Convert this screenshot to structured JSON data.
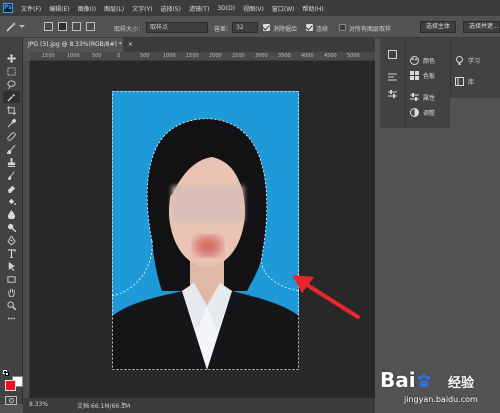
{
  "menubar": {
    "logo": "Ps",
    "items": [
      "文件(F)",
      "编辑(E)",
      "图像(I)",
      "图层(L)",
      "文字(Y)",
      "选择(S)",
      "滤镜(T)",
      "3D(D)",
      "视图(V)",
      "窗口(W)",
      "帮助(H)"
    ]
  },
  "options": {
    "sample_size_label": "取样大小：",
    "sample_size_value": "取样点",
    "tolerance_label": "容差：",
    "tolerance_value": "32",
    "antialias_label": "消除锯齿",
    "contiguous_label": "连续",
    "sample_all_label": "对所有图层取样",
    "select_subject_button": "选择主体",
    "select_and_mask_button": "选择并遮..."
  },
  "document": {
    "tab_title": "JPG (3).jpg @ 8.33%(RGB/8#) *",
    "tab_close": "×"
  },
  "rulers": {
    "top": [
      "1500",
      "1000",
      "500",
      "0",
      "500",
      "1000",
      "1500",
      "2000",
      "2500",
      "3000",
      "3500",
      "4000",
      "4500",
      "5000"
    ]
  },
  "statusbar": {
    "zoom": "8.33%",
    "doc_info": "文档:66.1M/66.1M"
  },
  "panels": {
    "group1": [
      {
        "icon": "color-icon",
        "label": "颜色"
      },
      {
        "icon": "swatches-icon",
        "label": "色板"
      },
      {
        "icon": "properties-icon",
        "label": "属性"
      },
      {
        "icon": "adjustments-icon",
        "label": "调整"
      }
    ],
    "group2": [
      {
        "icon": "learn-icon",
        "label": "学习"
      },
      {
        "icon": "libraries-icon",
        "label": "库"
      }
    ]
  },
  "colors": {
    "foreground": "#e8141c",
    "background": "#ffffff",
    "photo_bg": "#1e9ad8",
    "arrow": "#e8262c"
  },
  "watermark": {
    "brand": "Bai",
    "brand2": "经验",
    "url": "jingyan.baidu.com"
  }
}
